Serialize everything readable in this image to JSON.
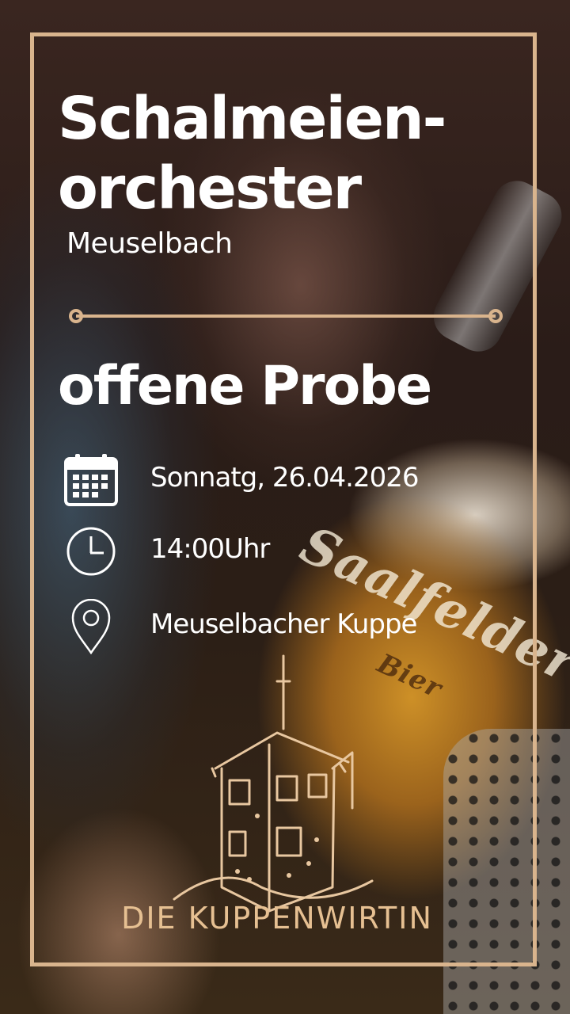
{
  "poster": {
    "title": "Schalmeien-\norchester",
    "subtitle": "Meuselbach",
    "event_title": "offene Probe",
    "details": {
      "date": "Sonnatg, 26.04.2026",
      "time": "14:00Uhr",
      "location": "Meuselbacher Kuppe"
    },
    "logo_text": "DIE KUPPENWIRTIN",
    "accent_color": "#d9b48d"
  },
  "background": {
    "glass_brand": "Saalfelder",
    "glass_sub": "Bier"
  },
  "icons": [
    "calendar-icon",
    "clock-icon",
    "location-pin-icon"
  ]
}
